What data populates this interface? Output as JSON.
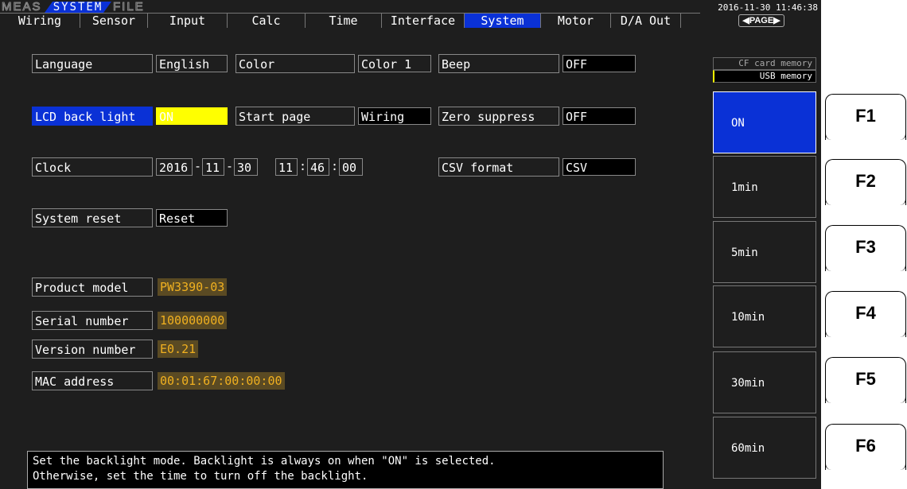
{
  "header": {
    "modes": [
      "MEAS",
      "SYSTEM",
      "FILE"
    ],
    "active_mode": "SYSTEM",
    "datetime": "2016-11-30 11:46:38"
  },
  "tabs": [
    "Wiring",
    "Sensor",
    "Input",
    "Calc",
    "Time",
    "Interface",
    "System",
    "Motor",
    "D/A Out"
  ],
  "active_tab": "System",
  "page_button": "◀PAGE▶",
  "settings": {
    "language_label": "Language",
    "language_value": "English",
    "color_label": "Color",
    "color_value": "Color 1",
    "beep_label": "Beep",
    "beep_value": "OFF",
    "backlight_label": "LCD back light",
    "backlight_value": "ON",
    "start_page_label": "Start page",
    "start_page_value": "Wiring",
    "zero_suppress_label": "Zero suppress",
    "zero_suppress_value": "OFF",
    "clock_label": "Clock",
    "clock_year": "2016",
    "clock_month": "11",
    "clock_day": "30",
    "clock_hour": "11",
    "clock_min": "46",
    "clock_sec": "00",
    "csv_label": "CSV format",
    "csv_value": "CSV",
    "reset_label": "System reset",
    "reset_value": "Reset"
  },
  "device_info": {
    "model_label": "Product model",
    "model_value": "PW3390-03",
    "serial_label": "Serial number",
    "serial_value": "100000000",
    "version_label": "Version number",
    "version_value": "E0.21",
    "mac_label": "MAC address",
    "mac_value": "00:01:67:00:00:00"
  },
  "message": {
    "line1": "Set the backlight mode. Backlight is always on when \"ON\" is selected.",
    "line2": "Otherwise, set the time to turn off the backlight."
  },
  "storage": {
    "option1": "CF card memory",
    "option2": "USB   memory",
    "selected": "USB memory"
  },
  "softkeys": [
    "ON",
    "1min",
    "5min",
    "10min",
    "30min",
    "60min"
  ],
  "active_softkey": "ON",
  "function_buttons": [
    "F1",
    "F2",
    "F3",
    "F4",
    "F5",
    "F6"
  ]
}
